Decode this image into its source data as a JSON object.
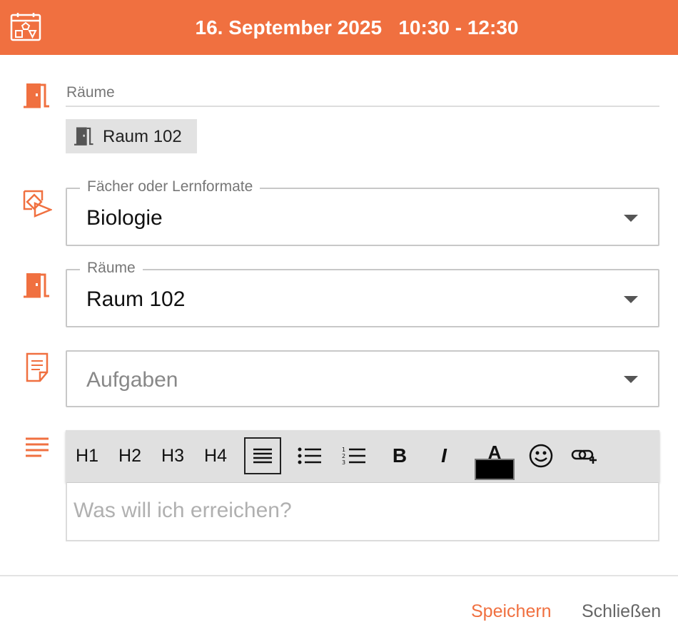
{
  "header": {
    "title": "16. September 2025   10:30 - 12:30",
    "icon": "calendar-shapes-icon",
    "color": "#f07040"
  },
  "rooms_section": {
    "label": "Räume",
    "chip": "Raum 102",
    "icon": "door-icon"
  },
  "subject_field": {
    "label": "Fächer oder Lernformate",
    "value": "Biologie",
    "icon": "subjects-icon"
  },
  "room_field": {
    "label": "Räume",
    "value": "Raum 102",
    "icon": "door-icon"
  },
  "tasks_field": {
    "placeholder": "Aufgaben",
    "icon": "document-icon"
  },
  "editor": {
    "icon": "text-lines-icon",
    "toolbar": [
      "H1",
      "H2",
      "H3",
      "H4"
    ],
    "bold": "B",
    "italic": "I",
    "font_color_letter": "A",
    "font_color_value": "#000000",
    "placeholder": "Was will ich erreichen?"
  },
  "footer": {
    "save": "Speichern",
    "close": "Schließen"
  }
}
